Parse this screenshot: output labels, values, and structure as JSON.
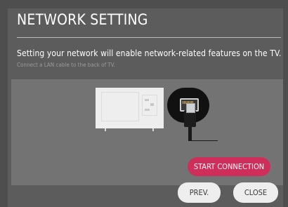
{
  "dialog": {
    "title": "NETWORK SETTING",
    "description": "Setting your network will enable network-related features on the TV.",
    "hint": "Connect a LAN cable to the back of TV."
  },
  "illustration": {
    "icons": [
      "tv-back-icon",
      "lan-port-icon",
      "lan-cable-icon"
    ]
  },
  "buttons": {
    "start_connection": "START CONNECTION",
    "prev": "PREV.",
    "close": "CLOSE"
  },
  "colors": {
    "background": "#4e4e4e",
    "dialog": "#5c5c5c",
    "panel": "#737373",
    "accent": "#cf2e5b",
    "secondary_button": "#eeeeee"
  }
}
